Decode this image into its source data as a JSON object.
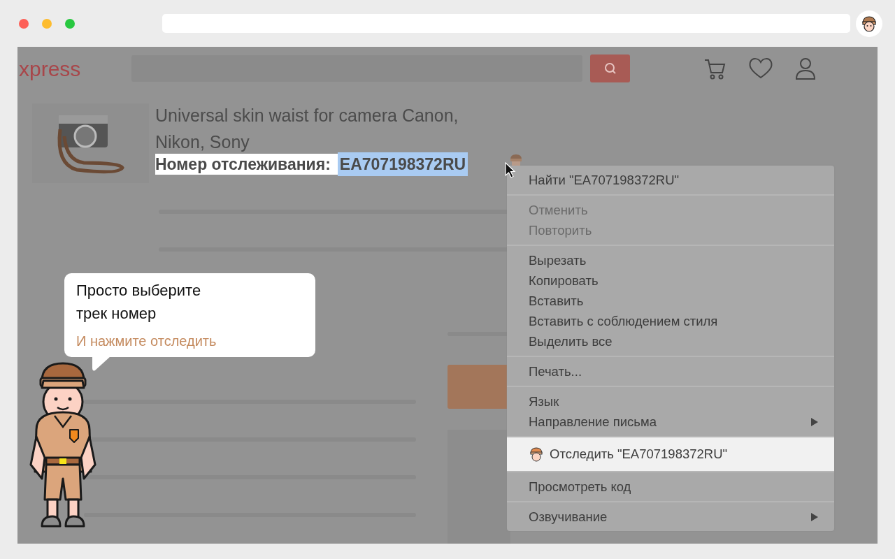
{
  "page": {
    "logo": "xpress",
    "product": {
      "title": "Universal skin waist for camera Canon, Nikon, Sony",
      "tracking_label": "Номер отслеживания:",
      "tracking_number": {
        "text": "EA707198372RU",
        "selected": true
      }
    }
  },
  "context_menu": {
    "groups": [
      {
        "items": [
          {
            "label": "Найти \"EA707198372RU\"",
            "disabled": false,
            "selected": false,
            "submenu": false,
            "kind": "plain"
          }
        ]
      },
      {
        "items": [
          {
            "label": "Отменить",
            "disabled": true,
            "selected": false,
            "submenu": false,
            "kind": "plain"
          },
          {
            "label": "Повторить",
            "disabled": true,
            "selected": false,
            "submenu": false,
            "kind": "plain"
          }
        ]
      },
      {
        "items": [
          {
            "label": "Вырезать",
            "disabled": false,
            "selected": false,
            "submenu": false,
            "kind": "plain"
          },
          {
            "label": "Копировать",
            "disabled": false,
            "selected": false,
            "submenu": false,
            "kind": "plain"
          },
          {
            "label": "Вставить",
            "disabled": false,
            "selected": false,
            "submenu": false,
            "kind": "plain"
          },
          {
            "label": "Вставить с соблюдением стиля",
            "disabled": false,
            "selected": false,
            "submenu": false,
            "kind": "plain"
          },
          {
            "label": "Выделить все",
            "disabled": false,
            "selected": false,
            "submenu": false,
            "kind": "plain"
          }
        ]
      },
      {
        "items": [
          {
            "label": "Печать...",
            "disabled": false,
            "selected": false,
            "submenu": false,
            "kind": "plain"
          }
        ]
      },
      {
        "items": [
          {
            "label": "Язык",
            "disabled": false,
            "selected": false,
            "submenu": false,
            "kind": "plain"
          },
          {
            "label": "Направление письма",
            "disabled": false,
            "selected": false,
            "submenu": true,
            "kind": "plain"
          }
        ]
      },
      {
        "items": [
          {
            "label": "Отследить \"EA707198372RU\"",
            "disabled": false,
            "selected": true,
            "submenu": false,
            "kind": "extension"
          }
        ]
      },
      {
        "items": [
          {
            "label": "Просмотреть код",
            "disabled": false,
            "selected": false,
            "submenu": false,
            "kind": "plain"
          }
        ]
      },
      {
        "items": [
          {
            "label": "Озвучивание",
            "disabled": false,
            "selected": false,
            "submenu": true,
            "kind": "plain"
          }
        ]
      }
    ]
  },
  "tip": {
    "lines": [
      "Просто выберите",
      "трек номер"
    ],
    "action": "И нажмите отследить"
  }
}
